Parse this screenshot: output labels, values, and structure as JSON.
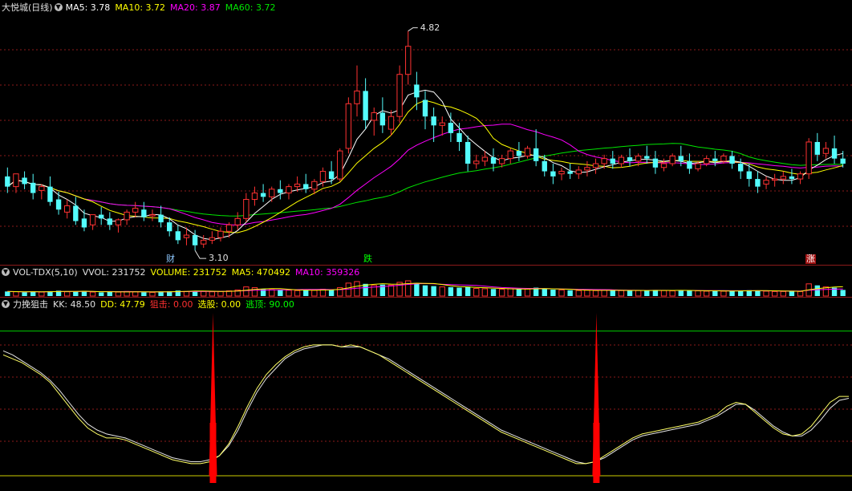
{
  "colors": {
    "up": "#ff3232",
    "down": "#54fcfc",
    "ma5": "#ffffff",
    "ma10": "#ffff00",
    "ma20": "#ff00ff",
    "ma60": "#00e600",
    "grid": "#8b1a1a",
    "white_text": "#e0e0e0",
    "kk": "#ffff66",
    "dd": "#e6e6e6",
    "bar": "#ff0000",
    "upper_line": "#00cc00",
    "lower_line": "#cccc00"
  },
  "main_panel": {
    "title": "大悦城(日线)",
    "ma5": "MA5: 3.78",
    "ma10": "MA10: 3.72",
    "ma20": "MA20: 3.87",
    "ma60": "MA60: 3.72",
    "high_label": "4.82",
    "low_label": "3.10",
    "markers": [
      {
        "text": "财",
        "color": "#8ec8ff"
      },
      {
        "text": "跌",
        "color": "#00ff00"
      },
      {
        "text": "涨",
        "color": "#ffffff",
        "bg": "#a01010"
      }
    ]
  },
  "volume_panel": {
    "title": "VOL-TDX(5,10)",
    "vvol": "VVOL: 231752",
    "volume": "VOLUME: 231752",
    "ma5": "MA5: 470492",
    "ma10": "MA10: 359326"
  },
  "indicator_panel": {
    "title": "力挽狙击",
    "kk": "KK: 48.50",
    "dd": "DD: 47.79",
    "snipe": "狙击: 0.00",
    "pick": "选股: 0.00",
    "top": "逃顶: 90.00"
  },
  "chart_data": {
    "type": "candlestick",
    "ylim": [
      3.0,
      4.95
    ],
    "high": 4.82,
    "low": 3.1,
    "candles": [
      [
        3.68,
        3.75,
        3.6,
        3.55
      ],
      [
        3.6,
        3.66,
        3.7,
        3.55
      ],
      [
        3.67,
        3.72,
        3.62,
        3.58
      ],
      [
        3.63,
        3.7,
        3.55,
        3.5
      ],
      [
        3.57,
        3.62,
        3.6,
        3.5
      ],
      [
        3.6,
        3.68,
        3.48,
        3.45
      ],
      [
        3.5,
        3.56,
        3.42,
        3.38
      ],
      [
        3.4,
        3.5,
        3.45,
        3.35
      ],
      [
        3.45,
        3.52,
        3.33,
        3.3
      ],
      [
        3.35,
        3.42,
        3.28,
        3.25
      ],
      [
        3.3,
        3.36,
        3.38,
        3.26
      ],
      [
        3.38,
        3.44,
        3.35,
        3.3
      ],
      [
        3.35,
        3.4,
        3.3,
        3.26
      ],
      [
        3.3,
        3.35,
        3.34,
        3.24
      ],
      [
        3.34,
        3.42,
        3.4,
        3.3
      ],
      [
        3.4,
        3.48,
        3.43,
        3.36
      ],
      [
        3.42,
        3.48,
        3.36,
        3.33
      ],
      [
        3.37,
        3.42,
        3.38,
        3.33
      ],
      [
        3.38,
        3.45,
        3.32,
        3.28
      ],
      [
        3.32,
        3.36,
        3.25,
        3.21
      ],
      [
        3.25,
        3.3,
        3.18,
        3.15
      ],
      [
        3.2,
        3.28,
        3.22,
        3.14
      ],
      [
        3.22,
        3.26,
        3.14,
        3.1
      ],
      [
        3.15,
        3.22,
        3.18,
        3.12
      ],
      [
        3.18,
        3.25,
        3.2,
        3.15
      ],
      [
        3.2,
        3.28,
        3.25,
        3.17
      ],
      [
        3.25,
        3.32,
        3.3,
        3.2
      ],
      [
        3.3,
        3.4,
        3.35,
        3.26
      ],
      [
        3.35,
        3.55,
        3.5,
        3.32
      ],
      [
        3.5,
        3.6,
        3.55,
        3.45
      ],
      [
        3.55,
        3.62,
        3.52,
        3.48
      ],
      [
        3.52,
        3.6,
        3.58,
        3.48
      ],
      [
        3.58,
        3.65,
        3.55,
        3.5
      ],
      [
        3.55,
        3.62,
        3.6,
        3.5
      ],
      [
        3.6,
        3.68,
        3.62,
        3.56
      ],
      [
        3.62,
        3.7,
        3.58,
        3.55
      ],
      [
        3.58,
        3.66,
        3.64,
        3.54
      ],
      [
        3.64,
        3.75,
        3.72,
        3.6
      ],
      [
        3.72,
        3.8,
        3.66,
        3.62
      ],
      [
        3.66,
        3.9,
        3.88,
        3.64
      ],
      [
        3.9,
        4.3,
        4.25,
        3.86
      ],
      [
        4.25,
        4.55,
        4.35,
        4.15
      ],
      [
        4.35,
        4.45,
        4.12,
        4.05
      ],
      [
        4.12,
        4.22,
        4.18,
        4.0
      ],
      [
        4.18,
        4.3,
        4.08,
        4.02
      ],
      [
        4.05,
        4.2,
        4.15,
        4.0
      ],
      [
        4.15,
        4.55,
        4.48,
        4.1
      ],
      [
        4.48,
        4.82,
        4.7,
        4.4
      ],
      [
        4.4,
        4.5,
        4.3,
        4.2
      ],
      [
        4.28,
        4.35,
        4.15,
        4.05
      ],
      [
        4.15,
        4.22,
        4.08,
        3.95
      ],
      [
        4.08,
        4.15,
        4.1,
        4.0
      ],
      [
        4.1,
        4.18,
        4.02,
        3.95
      ],
      [
        4.02,
        4.1,
        3.95,
        3.88
      ],
      [
        3.95,
        4.0,
        3.78,
        3.72
      ],
      [
        3.78,
        3.85,
        3.8,
        3.74
      ],
      [
        3.8,
        3.88,
        3.83,
        3.76
      ],
      [
        3.83,
        3.9,
        3.78,
        3.72
      ],
      [
        3.78,
        3.85,
        3.82,
        3.75
      ],
      [
        3.82,
        3.9,
        3.88,
        3.78
      ],
      [
        3.88,
        3.95,
        3.84,
        3.8
      ],
      [
        3.84,
        3.92,
        3.9,
        3.82
      ],
      [
        3.9,
        4.05,
        3.8,
        3.76
      ],
      [
        3.8,
        3.85,
        3.72,
        3.68
      ],
      [
        3.72,
        3.78,
        3.68,
        3.62
      ],
      [
        3.7,
        3.75,
        3.72,
        3.65
      ],
      [
        3.72,
        3.78,
        3.7,
        3.66
      ],
      [
        3.7,
        3.76,
        3.73,
        3.66
      ],
      [
        3.73,
        3.8,
        3.75,
        3.68
      ],
      [
        3.75,
        3.82,
        3.78,
        3.7
      ],
      [
        3.78,
        3.85,
        3.82,
        3.74
      ],
      [
        3.82,
        3.88,
        3.78,
        3.74
      ],
      [
        3.78,
        3.85,
        3.83,
        3.75
      ],
      [
        3.83,
        3.9,
        3.8,
        3.76
      ],
      [
        3.8,
        3.86,
        3.84,
        3.76
      ],
      [
        3.84,
        3.92,
        3.82,
        3.78
      ],
      [
        3.82,
        3.88,
        3.75,
        3.7
      ],
      [
        3.75,
        3.82,
        3.78,
        3.72
      ],
      [
        3.78,
        3.86,
        3.84,
        3.76
      ],
      [
        3.84,
        3.92,
        3.8,
        3.76
      ],
      [
        3.8,
        3.86,
        3.74,
        3.7
      ],
      [
        3.74,
        3.8,
        3.78,
        3.72
      ],
      [
        3.78,
        3.84,
        3.82,
        3.76
      ],
      [
        3.82,
        3.88,
        3.8,
        3.76
      ],
      [
        3.8,
        3.86,
        3.84,
        3.78
      ],
      [
        3.84,
        3.88,
        3.78,
        3.74
      ],
      [
        3.78,
        3.82,
        3.72,
        3.66
      ],
      [
        3.72,
        3.78,
        3.66,
        3.6
      ],
      [
        3.66,
        3.72,
        3.6,
        3.55
      ],
      [
        3.62,
        3.68,
        3.65,
        3.58
      ],
      [
        3.65,
        3.7,
        3.66,
        3.6
      ],
      [
        3.66,
        3.72,
        3.68,
        3.62
      ],
      [
        3.68,
        3.74,
        3.66,
        3.62
      ],
      [
        3.66,
        3.72,
        3.7,
        3.62
      ],
      [
        3.7,
        3.98,
        3.95,
        3.66
      ],
      [
        3.95,
        4.02,
        3.85,
        3.8
      ],
      [
        3.86,
        3.95,
        3.9,
        3.82
      ],
      [
        3.9,
        4.0,
        3.82,
        3.78
      ],
      [
        3.82,
        3.88,
        3.78,
        3.75
      ]
    ],
    "volume": [
      0.3,
      0.28,
      0.25,
      0.3,
      0.26,
      0.32,
      0.35,
      0.28,
      0.3,
      0.34,
      0.26,
      0.24,
      0.28,
      0.26,
      0.3,
      0.28,
      0.25,
      0.24,
      0.3,
      0.32,
      0.36,
      0.3,
      0.34,
      0.3,
      0.28,
      0.3,
      0.34,
      0.4,
      0.6,
      0.55,
      0.45,
      0.42,
      0.4,
      0.38,
      0.36,
      0.4,
      0.38,
      0.45,
      0.42,
      0.55,
      0.85,
      0.95,
      0.8,
      0.7,
      0.75,
      0.72,
      0.9,
      1.0,
      0.85,
      0.7,
      0.65,
      0.6,
      0.58,
      0.55,
      0.62,
      0.5,
      0.48,
      0.46,
      0.44,
      0.48,
      0.45,
      0.46,
      0.55,
      0.48,
      0.42,
      0.4,
      0.38,
      0.36,
      0.38,
      0.36,
      0.4,
      0.38,
      0.36,
      0.34,
      0.36,
      0.38,
      0.4,
      0.36,
      0.34,
      0.38,
      0.36,
      0.34,
      0.32,
      0.34,
      0.32,
      0.34,
      0.36,
      0.38,
      0.36,
      0.32,
      0.3,
      0.3,
      0.32,
      0.3,
      0.8,
      0.7,
      0.6,
      0.55,
      0.4
    ],
    "kk": [
      78,
      76,
      74,
      71,
      68,
      64,
      58,
      52,
      46,
      41,
      38,
      36,
      36,
      35,
      33,
      31,
      29,
      27,
      25,
      24,
      23,
      23,
      24,
      27,
      33,
      42,
      52,
      61,
      68,
      73,
      77,
      80,
      82,
      83,
      83,
      83,
      82,
      83,
      82,
      80,
      78,
      75,
      72,
      69,
      66,
      63,
      60,
      57,
      54,
      51,
      48,
      45,
      42,
      39,
      37,
      35,
      33,
      31,
      29,
      27,
      25,
      23,
      23,
      24,
      27,
      30,
      33,
      36,
      38,
      39,
      40,
      41,
      42,
      43,
      44,
      46,
      48,
      52,
      54,
      53,
      49,
      45,
      41,
      38,
      37,
      38,
      42,
      48,
      54,
      57,
      57
    ],
    "dd": [
      80,
      78,
      75,
      72,
      69,
      65,
      60,
      54,
      48,
      43,
      40,
      38,
      37,
      36,
      34,
      32,
      30,
      28,
      26,
      25,
      24,
      24,
      25,
      27,
      32,
      40,
      50,
      59,
      66,
      71,
      76,
      79,
      81,
      82,
      83,
      83,
      82,
      82,
      82,
      80,
      78,
      76,
      73,
      70,
      67,
      64,
      61,
      58,
      55,
      52,
      49,
      46,
      43,
      40,
      38,
      36,
      34,
      32,
      30,
      28,
      26,
      24,
      23,
      24,
      26,
      29,
      32,
      35,
      37,
      38,
      39,
      40,
      41,
      42,
      43,
      45,
      47,
      50,
      53,
      53,
      50,
      46,
      42,
      39,
      37,
      37,
      40,
      45,
      51,
      55,
      56
    ],
    "snipe_positions": [
      0.25,
      0.7
    ],
    "kk_range": [
      10,
      100
    ],
    "top_line": 90,
    "bottom_line": 10
  }
}
